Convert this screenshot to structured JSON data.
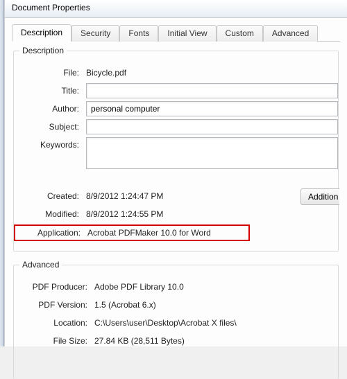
{
  "window": {
    "title": "Document Properties"
  },
  "tabs": [
    {
      "label": "Description"
    },
    {
      "label": "Security"
    },
    {
      "label": "Fonts"
    },
    {
      "label": "Initial View"
    },
    {
      "label": "Custom"
    },
    {
      "label": "Advanced"
    }
  ],
  "description": {
    "legend": "Description",
    "labels": {
      "file": "File:",
      "title": "Title:",
      "author": "Author:",
      "subject": "Subject:",
      "keywords": "Keywords:",
      "created": "Created:",
      "modified": "Modified:",
      "application": "Application:"
    },
    "values": {
      "file": "Bicycle.pdf",
      "title": "",
      "author": "personal computer",
      "subject": "",
      "keywords": "",
      "created": "8/9/2012 1:24:47 PM",
      "modified": "8/9/2012 1:24:55 PM",
      "application": "Acrobat PDFMaker 10.0 for Word"
    },
    "button_additional": "Addition"
  },
  "advanced": {
    "legend": "Advanced",
    "labels": {
      "producer": "PDF Producer:",
      "version": "PDF Version:",
      "location": "Location:",
      "filesize": "File Size:"
    },
    "values": {
      "producer": "Adobe PDF Library 10.0",
      "version": "1.5 (Acrobat 6.x)",
      "location": "C:\\Users\\user\\Desktop\\Acrobat X files\\",
      "filesize": "27.84 KB (28,511 Bytes)"
    }
  }
}
